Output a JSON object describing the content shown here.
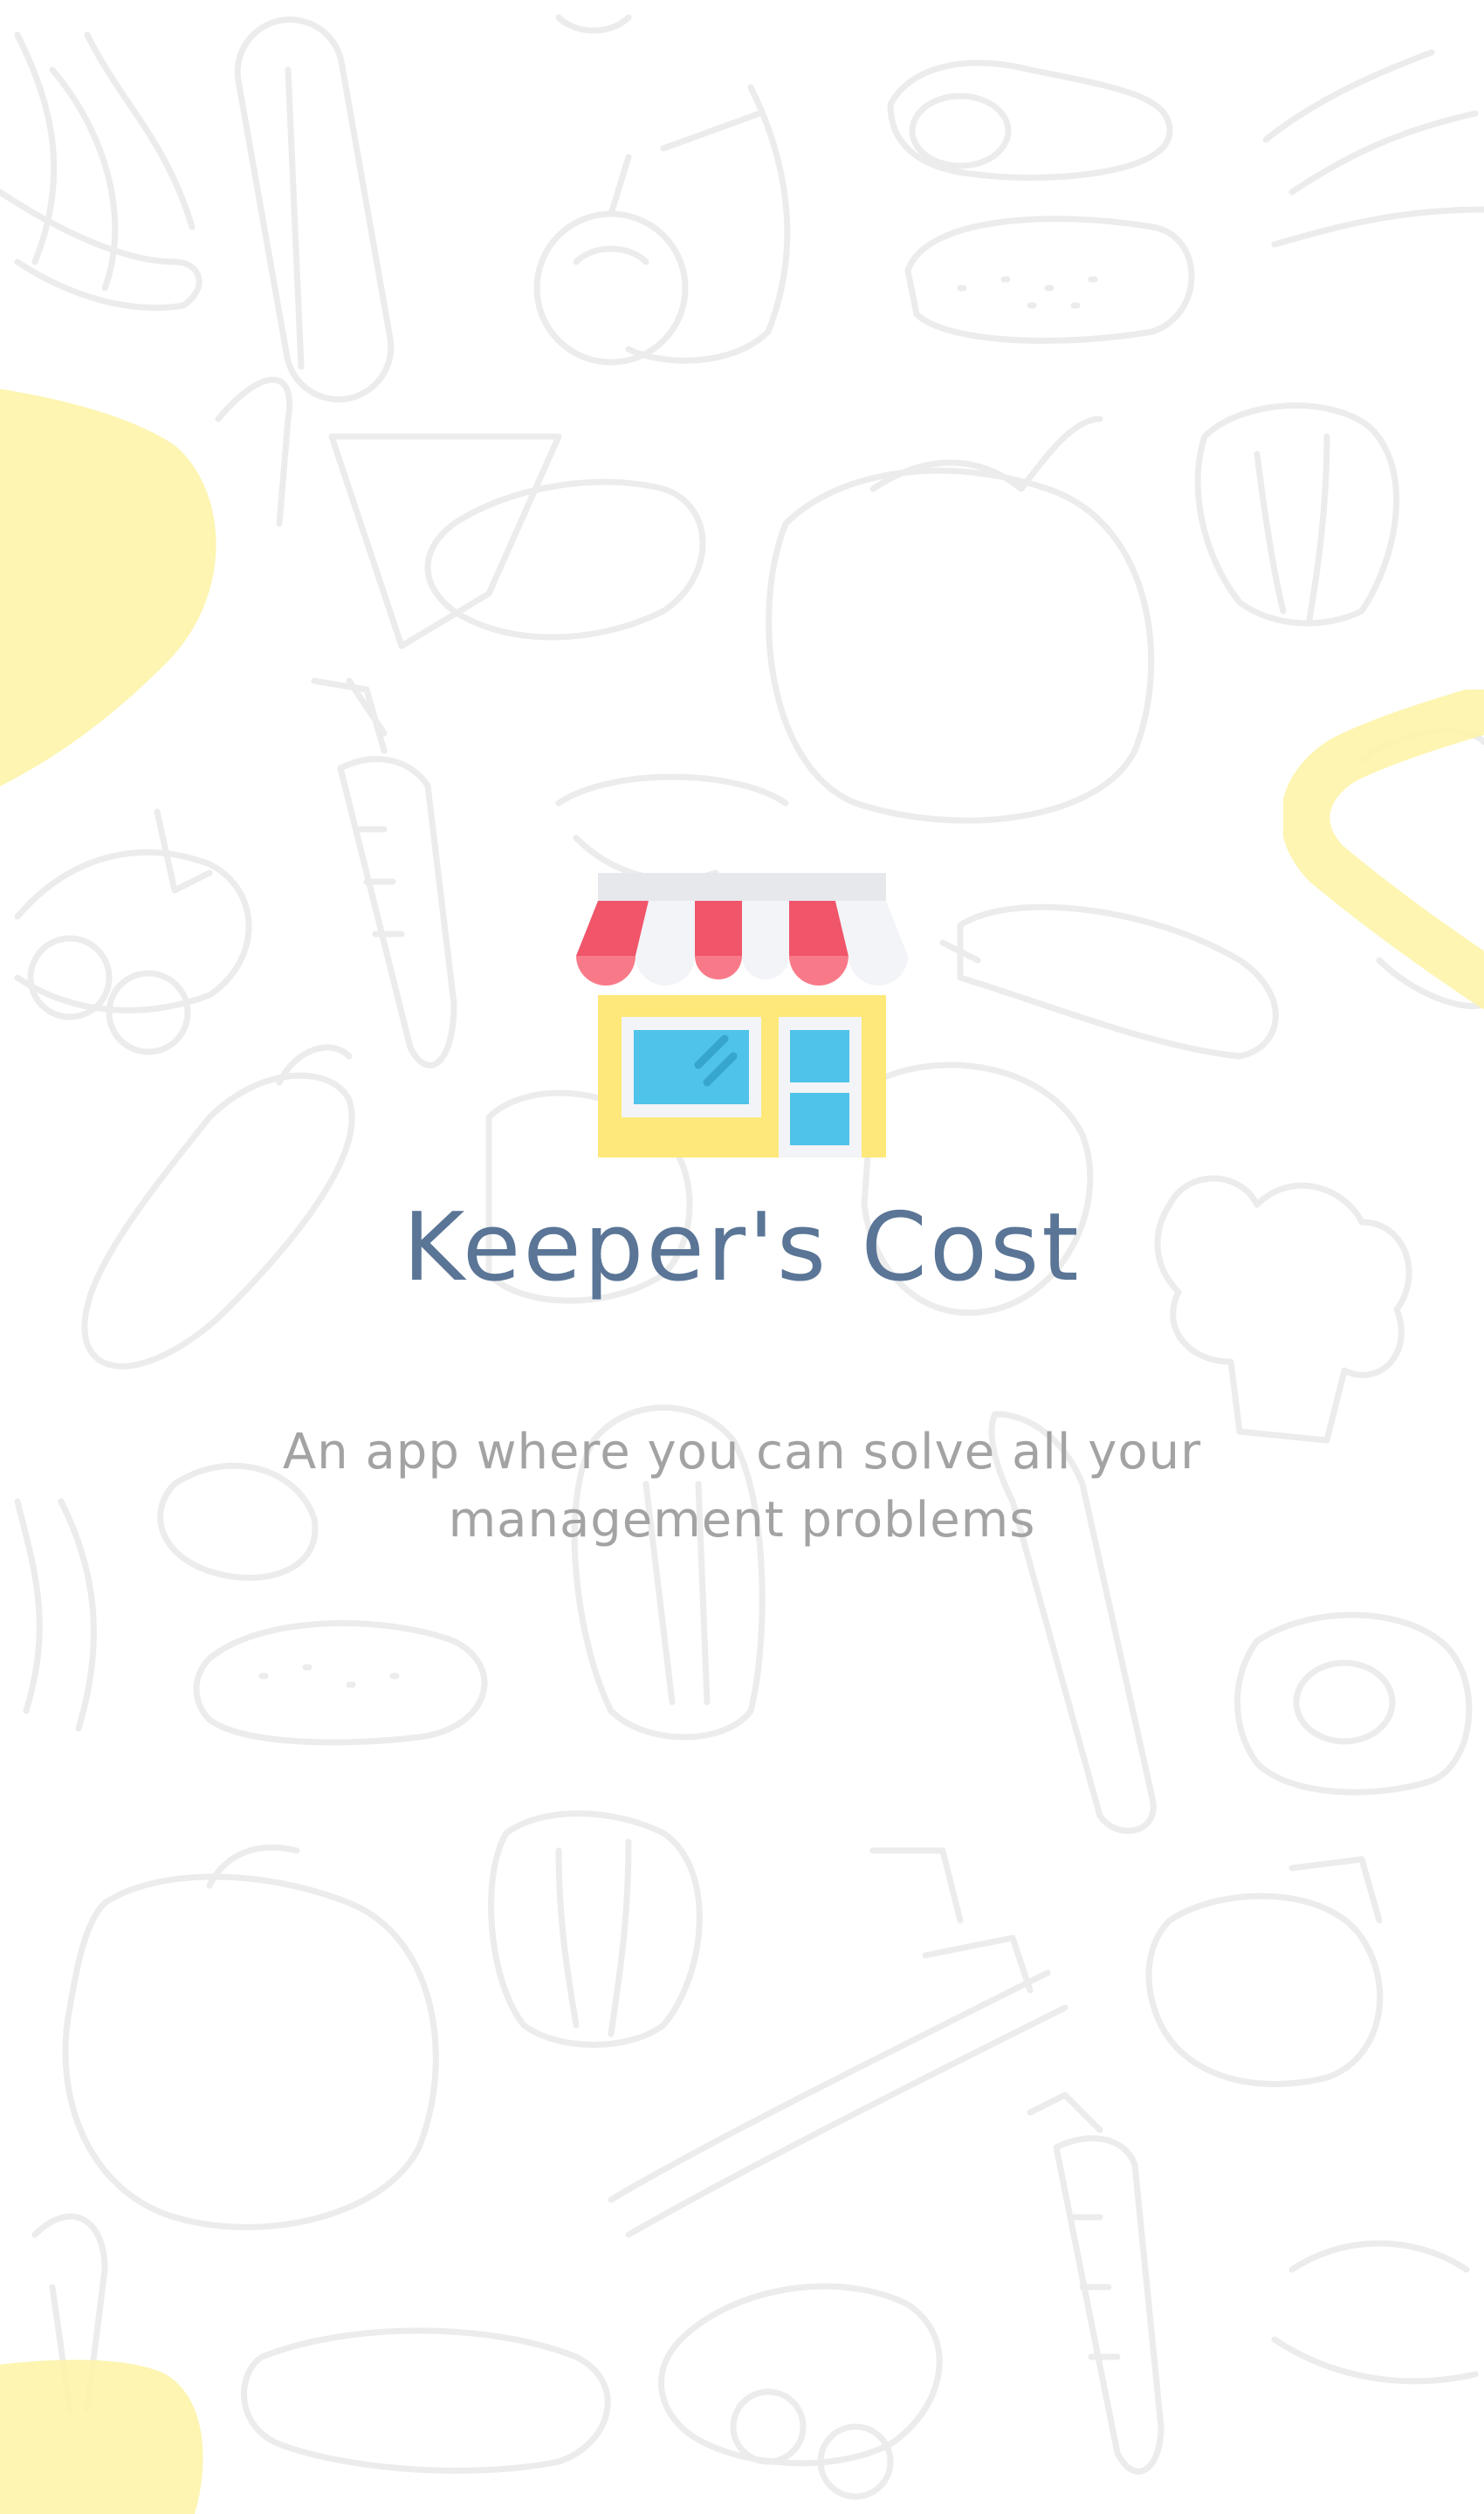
{
  "app": {
    "title": "Keeper's Cost",
    "tagline": "An app where you can solve all your management problems"
  },
  "icons": {
    "logo": "store-icon",
    "background": "vegetables-doodle-pattern"
  },
  "colors": {
    "background": "#ffffff",
    "title": "#5a7596",
    "tagline": "#a3a3a3",
    "accent_yellow": "#fdf4a9",
    "doodle_stroke": "#ececec",
    "awning_red": "#f0556a",
    "awning_white": "#f2f4f7",
    "store_wall": "#fee879",
    "window_blue": "#4fc3e9"
  }
}
